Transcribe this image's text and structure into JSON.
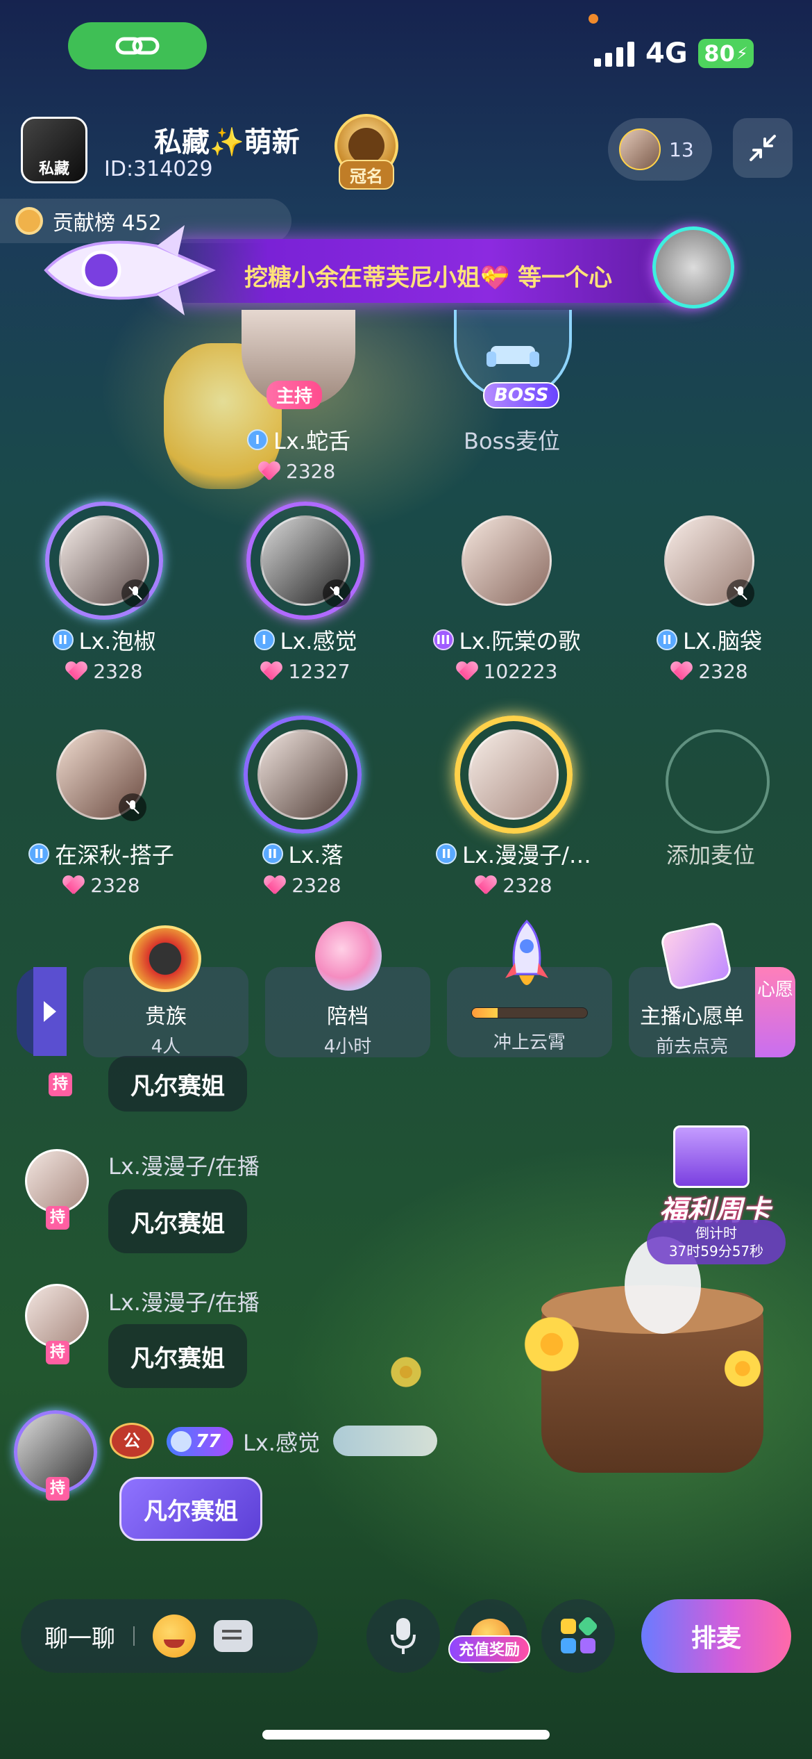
{
  "status_bar": {
    "network": "4G",
    "battery": "80"
  },
  "header": {
    "room_avatar_label": "私藏",
    "room_name": "私藏✨萌新",
    "room_id": "ID:314029",
    "crown_label": "冠名",
    "online_count": "13",
    "contribution_label": "贡献榜 452"
  },
  "banner": {
    "text": "挖糖小余在蒂芙尼小姐💝 等一个心"
  },
  "host": {
    "tag": "主持",
    "name": "Lx.蛇舌",
    "score": "2328"
  },
  "boss": {
    "tag": "BOSS",
    "label": "Boss麦位"
  },
  "seats_row1": [
    {
      "name": "Lx.泡椒",
      "score": "2328",
      "badge": "II"
    },
    {
      "name": "Lx.感觉",
      "score": "12327",
      "badge": "I"
    },
    {
      "name": "Lx.阮棠の歌",
      "score": "102223",
      "badge": "III"
    },
    {
      "name": "LX.脑袋",
      "score": "2328",
      "badge": "II"
    }
  ],
  "seats_row2": [
    {
      "name": "在深秋-搭子",
      "score": "2328",
      "badge": "II"
    },
    {
      "name": "Lx.落",
      "score": "2328",
      "badge": "II"
    },
    {
      "name": "Lx.漫漫子/…",
      "score": "2328",
      "badge": "II"
    },
    {
      "name": "添加麦位",
      "score": ""
    }
  ],
  "features": [
    {
      "title": "贵族",
      "sub": "4人"
    },
    {
      "title": "陪档",
      "sub": "4小时"
    },
    {
      "title": "",
      "sub": "冲上云霄",
      "progress": 0.22
    },
    {
      "title": "主播心愿单",
      "sub": "前去点亮",
      "tab": "心愿"
    }
  ],
  "chat": {
    "partial_tag": "持",
    "partial_text": "凡尔赛姐",
    "messages": [
      {
        "user": "Lx.漫漫子/在播",
        "tag": "持",
        "text": "凡尔赛姐"
      },
      {
        "user": "Lx.漫漫子/在播",
        "tag": "持",
        "text": "凡尔赛姐"
      },
      {
        "user": "Lx.感觉",
        "tag": "持",
        "text": "凡尔赛姐",
        "gong": "公",
        "level": "77"
      }
    ]
  },
  "welfare": {
    "title": "福利周卡",
    "countdown_label": "倒计时",
    "countdown": "37时59分57秒"
  },
  "bottom": {
    "chat_label": "聊一聊",
    "recharge_label": "充值奖励",
    "queue_label": "排麦"
  }
}
